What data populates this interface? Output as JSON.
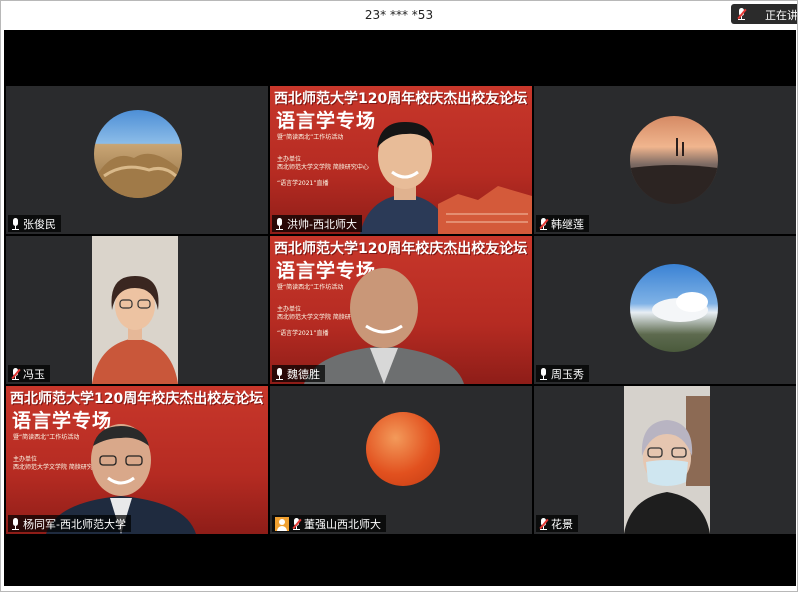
{
  "topbar": {
    "meeting_id": "23* *** *53",
    "speaking_label": "正在讲"
  },
  "banner": {
    "title": "西北师范大学120周年校庆杰出校友论坛",
    "subtitle": "语言学专场",
    "tagline": "暨“简读西北”工作坊活动",
    "organizer": "主办单位",
    "org_name": "西北师范大学文学院 简牍研究中心",
    "year_line": "“语言学2021”直播"
  },
  "participants": [
    {
      "name": "张俊民"
    },
    {
      "name": "洪帅-西北师大"
    },
    {
      "name": "韩继莲"
    },
    {
      "name": "冯玉"
    },
    {
      "name": "魏德胜"
    },
    {
      "name": "周玉秀"
    },
    {
      "name": "杨同军-西北师范大学"
    },
    {
      "name": "董强山西北师大"
    },
    {
      "name": "花景"
    }
  ],
  "icons": {
    "mic": "microphone-icon",
    "mic_muted": "microphone-muted-icon",
    "avatar_placeholder": "person-icon"
  }
}
